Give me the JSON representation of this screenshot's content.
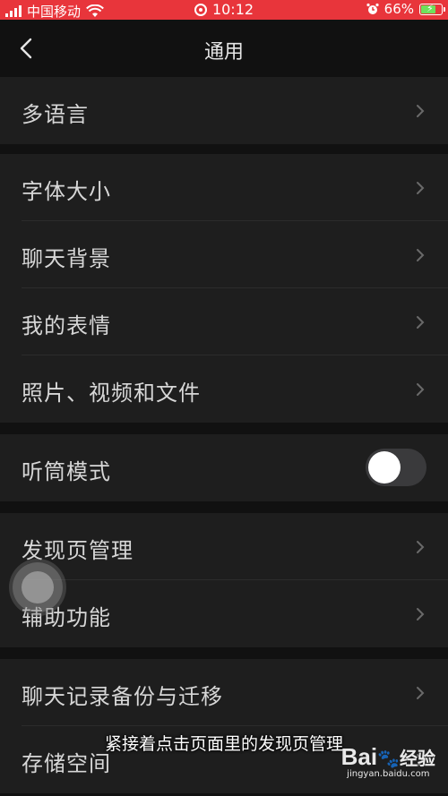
{
  "status_bar": {
    "carrier": "中国移动",
    "time": "10:12",
    "battery": "66%",
    "icons": [
      "signal-icon",
      "wifi-icon",
      "screen-record-icon",
      "alarm-icon",
      "battery-charging-icon"
    ]
  },
  "nav": {
    "title": "通用",
    "back_icon": "chevron-left-icon"
  },
  "groups": [
    {
      "items": [
        {
          "label": "多语言"
        }
      ]
    },
    {
      "items": [
        {
          "label": "字体大小"
        },
        {
          "label": "聊天背景"
        },
        {
          "label": "我的表情"
        },
        {
          "label": "照片、视频和文件"
        }
      ]
    },
    {
      "items": [
        {
          "label": "听筒模式",
          "toggle": false
        }
      ]
    },
    {
      "items": [
        {
          "label": "发现页管理"
        },
        {
          "label": "辅助功能"
        }
      ]
    },
    {
      "items": [
        {
          "label": "聊天记录备份与迁移"
        },
        {
          "label": "存储空间"
        }
      ]
    }
  ],
  "overlay": {
    "caption": "紧接着点击页面里的发现页管理",
    "watermark_logo": "Bai",
    "watermark_logo_suffix": "经验",
    "watermark_url": "jingyan.baidu.com"
  },
  "colors": {
    "status_bar": "#e8353b",
    "background": "#111111",
    "cell": "#1e1e1e",
    "battery_fill": "#6fe05b"
  }
}
